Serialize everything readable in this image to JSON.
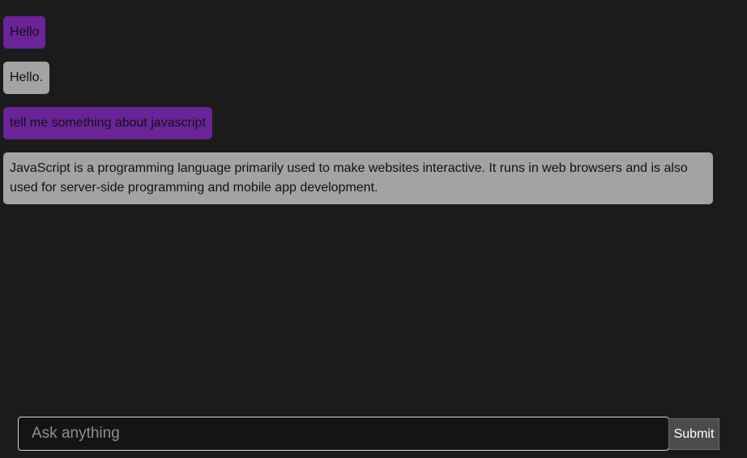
{
  "messages": [
    {
      "role": "user",
      "text": "Hello"
    },
    {
      "role": "assistant",
      "text": "Hello."
    },
    {
      "role": "user",
      "text": "tell me something about javascript"
    },
    {
      "role": "assistant",
      "text": "JavaScript is a programming language primarily used to make websites interactive. It runs in web browsers and is also used for server-side programming and mobile app development."
    }
  ],
  "input": {
    "placeholder": "Ask anything",
    "value": ""
  },
  "submit_label": "Submit",
  "colors": {
    "background": "#1b1b1b",
    "user_bubble": "#6a2497",
    "assistant_bubble": "#a3a3a3",
    "submit_button": "#4b4b4b"
  }
}
